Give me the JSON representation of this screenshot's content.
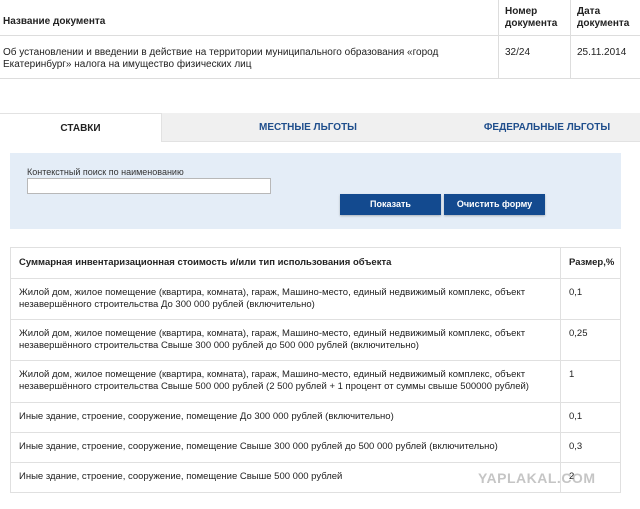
{
  "documents": {
    "headers": [
      "Название документа",
      "Номер документа",
      "Дата документа"
    ],
    "rows": [
      {
        "name": "Об установлении и введении в действие на территории муниципального образования «город Екатеринбург» налога на имущество физических лиц",
        "number": "32/24",
        "date": "25.11.2014"
      }
    ]
  },
  "tabs": [
    {
      "label": "СТАВКИ",
      "active": true
    },
    {
      "label": "МЕСТНЫЕ ЛЬГОТЫ",
      "active": false
    },
    {
      "label": "ФЕДЕРАЛЬНЫЕ ЛЬГОТЫ",
      "active": false
    }
  ],
  "search": {
    "label": "Контекстный поиск по наименованию",
    "value": "",
    "placeholder": "",
    "show_button": "Показать",
    "clear_button": "Очистить форму"
  },
  "rates": {
    "headers": [
      "Суммарная инвентаризационная стоимость и/или тип использования объекта",
      "Размер,%"
    ],
    "rows": [
      {
        "desc": "Жилой дом, жилое помещение (квартира, комната), гараж, Машино-место, единый недвижимый комплекс, объект незавершённого строительства До 300 000 рублей (включительно)",
        "value": "0,1"
      },
      {
        "desc": "Жилой дом, жилое помещение (квартира, комната), гараж, Машино-место, единый недвижимый комплекс, объект незавершённого строительства Свыше 300 000 рублей до 500 000 рублей (включительно)",
        "value": "0,25"
      },
      {
        "desc": "Жилой дом, жилое помещение (квартира, комната), гараж, Машино-место, единый недвижимый комплекс, объект незавершённого строительства Свыше 500 000 рублей (2 500 рублей + 1 процент от суммы свыше 500000 рублей)",
        "value": "1"
      },
      {
        "desc": "Иные здание, строение, сооружение, помещение До 300 000 рублей (включительно)",
        "value": "0,1"
      },
      {
        "desc": "Иные здание, строение, сооружение, помещение Свыше 300 000 рублей до 500 000 рублей (включительно)",
        "value": "0,3"
      },
      {
        "desc": "Иные здание, строение, сооружение, помещение Свыше 500 000 рублей",
        "value": "2"
      }
    ]
  },
  "watermark": "YAPLAKAL.COM",
  "colors": {
    "accent": "#134a8f",
    "tab_text": "#1f4e8c",
    "panel_bg": "#e4edf7"
  }
}
